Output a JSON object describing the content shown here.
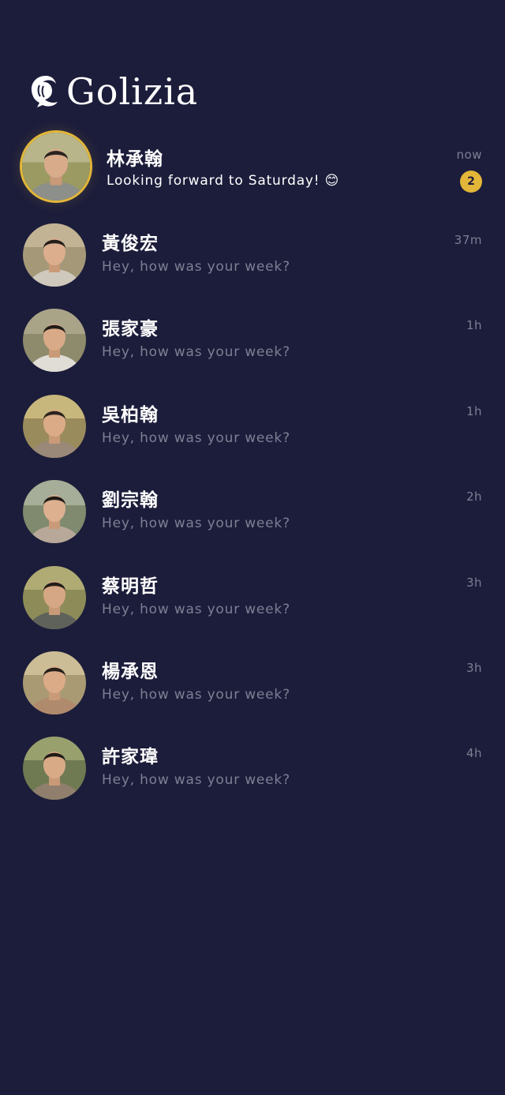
{
  "app": {
    "name": "Golizia"
  },
  "colors": {
    "background": "#1c1d3b",
    "accent": "#e2b638",
    "muted_text": "#7d7f93"
  },
  "chats": [
    {
      "name": "林承翰",
      "preview": "Looking forward to Saturday! 😊",
      "time": "now",
      "unread": "2"
    },
    {
      "name": "黃俊宏",
      "preview": "Hey, how was your week?",
      "time": "37m"
    },
    {
      "name": "張家豪",
      "preview": "Hey, how was your week?",
      "time": "1h"
    },
    {
      "name": "吳柏翰",
      "preview": "Hey, how was your week?",
      "time": "1h"
    },
    {
      "name": "劉宗翰",
      "preview": "Hey, how was your week?",
      "time": "2h"
    },
    {
      "name": "蔡明哲",
      "preview": "Hey, how was your week?",
      "time": "3h"
    },
    {
      "name": "楊承恩",
      "preview": "Hey, how was your week?",
      "time": "3h"
    },
    {
      "name": "許家瑋",
      "preview": "Hey, how was your week?",
      "time": "4h"
    }
  ]
}
